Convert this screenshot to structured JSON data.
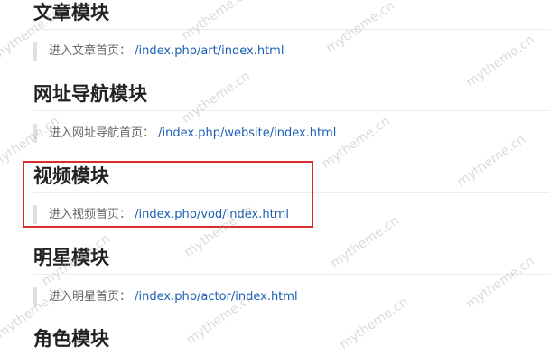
{
  "sections": [
    {
      "title": "文章模块",
      "entry_label": "进入文章首页：",
      "entry_link": "/index.php/art/index.html"
    },
    {
      "title": "网址导航模块",
      "entry_label": "进入网址导航首页：",
      "entry_link": "/index.php/website/index.html"
    },
    {
      "title": "视频模块",
      "entry_label": "进入视频首页：",
      "entry_link": "/index.php/vod/index.html"
    },
    {
      "title": "明星模块",
      "entry_label": "进入明星首页：",
      "entry_link": "/index.php/actor/index.html"
    },
    {
      "title": "角色模块"
    }
  ],
  "watermark_text": "mytheme.cn",
  "colors": {
    "link": "#1a5fb4",
    "heading": "#222222",
    "highlight": "#d92b2b",
    "quote_bar": "#dfe2e5"
  }
}
